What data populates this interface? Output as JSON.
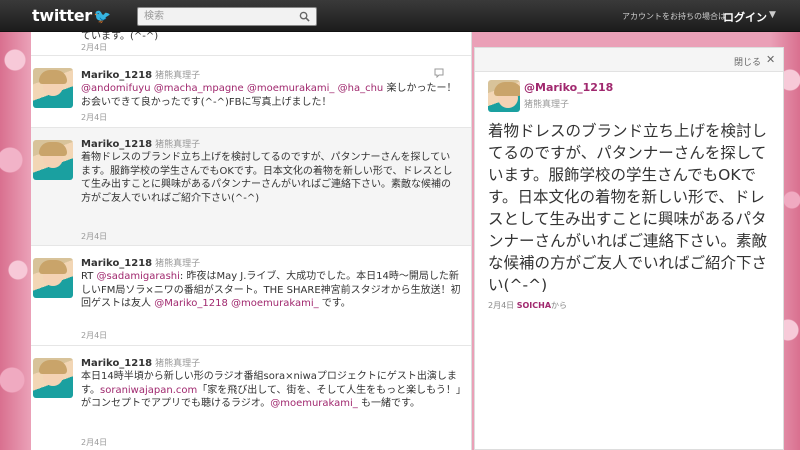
{
  "topbar": {
    "logo": "twitter",
    "search_placeholder": "検索",
    "account_hint": "アカウントをお持ちの場合は",
    "login_label": "ログイン",
    "login_caret": "▼"
  },
  "timeline": {
    "top_fragment": {
      "text": "ています。(^-^)",
      "date": "2月4日"
    },
    "tweets": [
      {
        "screen_name": "Mariko_1218",
        "real_name": "猪熊真理子",
        "segments": [
          {
            "t": "@andomifuyu",
            "m": true
          },
          {
            "t": " "
          },
          {
            "t": "@macha_mpagne",
            "m": true
          },
          {
            "t": " "
          },
          {
            "t": "@moemurakami_",
            "m": true
          },
          {
            "t": " "
          },
          {
            "t": "@ha_chu",
            "m": true
          },
          {
            "t": " 楽しかったー！お会いできて良かったです(^-^)FBに写真上げました！"
          }
        ],
        "date": "2月4日"
      },
      {
        "screen_name": "Mariko_1218",
        "real_name": "猪熊真理子",
        "segments": [
          {
            "t": "着物ドレスのブランド立ち上げを検討してるのですが、パタンナーさんを探しています。服飾学校の学生さんでもOKです。日本文化の着物を新しい形で、ドレスとして生み出すことに興味があるパタンナーさんがいればご連絡下さい。素敵な候補の方がご友人でいればご紹介下さい(^-^)"
          }
        ],
        "date": "2月4日"
      },
      {
        "screen_name": "Mariko_1218",
        "real_name": "猪熊真理子",
        "segments": [
          {
            "t": "RT "
          },
          {
            "t": "@sadamigarashi",
            "m": true
          },
          {
            "t": ": 昨夜はMay J.ライブ、大成功でした。本日14時〜開局した新しいFM局ソラ×ニワの番組がスタート。THE SHARE神宮前スタジオから生放送！初回ゲストは友人 "
          },
          {
            "t": "@Mariko_1218",
            "m": true
          },
          {
            "t": " "
          },
          {
            "t": "@moemurakami_",
            "m": true
          },
          {
            "t": " です。"
          }
        ],
        "date": "2月4日"
      },
      {
        "screen_name": "Mariko_1218",
        "real_name": "猪熊真理子",
        "segments": [
          {
            "t": "本日14時半頃から新しい形のラジオ番組sora×niwaプロジェクトにゲスト出演します。"
          },
          {
            "t": "soraniwajapan.com",
            "m": true
          },
          {
            "t": "「家を飛び出して、街を、そして人生をもっと楽しもう！」がコンセプトでアプリでも聴けるラジオ。"
          },
          {
            "t": "@moemurakami_",
            "m": true
          },
          {
            "t": " も一緒です。"
          }
        ],
        "date": "2月4日"
      }
    ]
  },
  "detail": {
    "close_label": "閉じる",
    "close_icon": "✕",
    "screen_name": "@Mariko_1218",
    "real_name": "猪熊真理子",
    "text": "着物ドレスのブランド立ち上げを検討してるのですが、パタンナーさんを探しています。服飾学校の学生さんでもOKです。日本文化の着物を新しい形で、ドレスとして生み出すことに興味があるパタンナーさんがいればご連絡下さい。素敵な候補の方がご友人でいればご紹介下さい(^-^)",
    "date": "2月4日",
    "source": "SOICHA",
    "source_suffix": "から"
  },
  "colors": {
    "accent": "#a0286e",
    "topbar": "#1c1c1c",
    "background": "#eaa0b7"
  }
}
